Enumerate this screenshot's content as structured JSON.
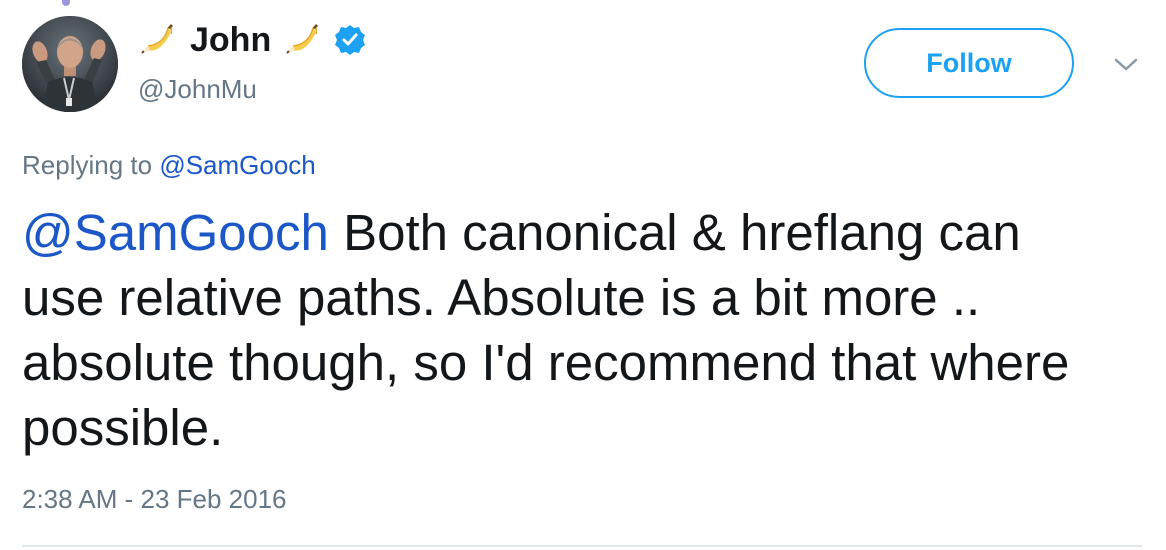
{
  "author": {
    "display_name": "John",
    "handle": "@JohnMu",
    "verified": true,
    "name_emoji": "banana-icon"
  },
  "actions": {
    "follow_label": "Follow",
    "more_icon": "chevron-down-icon"
  },
  "reply": {
    "prefix": "Replying to",
    "mention": "@SamGooch"
  },
  "tweet": {
    "mention": "@SamGooch",
    "text_line1": " Both canonical & hreflang can",
    "text_rest": "use relative paths. Absolute is a bit more .. absolute though, so I'd recommend that where possible."
  },
  "timestamp": "2:38 AM - 23 Feb 2016",
  "colors": {
    "link": "#1b57c7",
    "follow": "#1da1f2",
    "muted": "#657786",
    "text": "#14171a",
    "verified": "#1da1f2"
  }
}
